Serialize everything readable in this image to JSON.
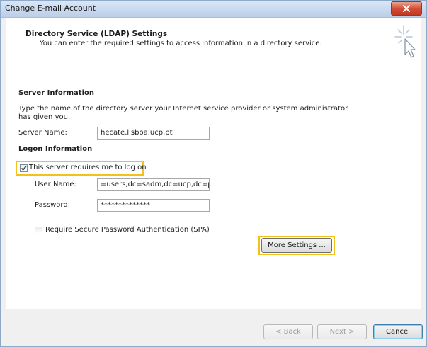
{
  "window": {
    "title": "Change E-mail Account",
    "close_icon": "close-icon"
  },
  "header": {
    "title": "Directory Service (LDAP) Settings",
    "subtitle": "You can enter the required settings to access information in a directory service.",
    "icon": "wizard-sparkle-cursor-icon"
  },
  "server_info": {
    "heading": "Server Information",
    "description_line1": "Type the name of the directory server your Internet service provider or system administrator",
    "description_line2": "has given you.",
    "server_name_label": "Server Name:",
    "server_name_value": "hecate.lisboa.ucp.pt"
  },
  "logon_info": {
    "heading": "Logon Information",
    "requires_logon_label": "This server requires me to log on",
    "requires_logon_checked": true,
    "user_name_label": "User Name:",
    "user_name_value": "=users,dc=sadm,dc=ucp,dc=pt",
    "password_label": "Password:",
    "password_value": "**************",
    "spa_label": "Require Secure Password Authentication (SPA)",
    "spa_checked": false
  },
  "buttons": {
    "more_settings": "More Settings ...",
    "back": "< Back",
    "next": "Next >",
    "cancel": "Cancel"
  },
  "colors": {
    "highlight": "#f2c21a",
    "close_button": "#d24a33"
  }
}
